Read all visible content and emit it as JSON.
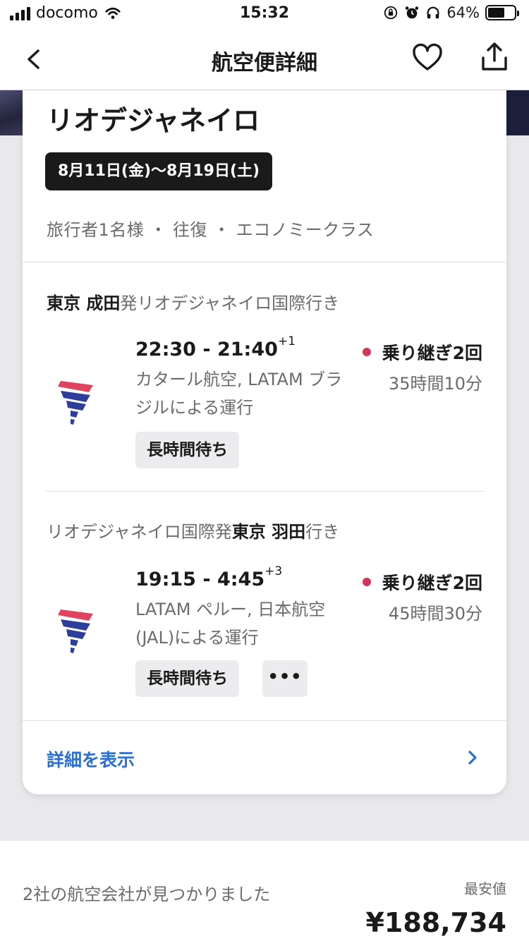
{
  "status_bar": {
    "carrier": "docomo",
    "time": "15:32",
    "battery": "64%",
    "battery_level": 0.64
  },
  "nav": {
    "title": "航空便詳細"
  },
  "trip": {
    "destination": "リオデジャネイロ",
    "dates": "8月11日(金)〜8月19日(土)",
    "travelers": "旅行者1名様 ・ 往復 ・ エコノミークラス"
  },
  "legs": [
    {
      "origin_bold": "東京 成田",
      "route_rest": "発リオデジャネイロ国際行き",
      "times": "22:30 - 21:40",
      "day_offset": "+1",
      "stops": "乗り継ぎ2回",
      "airlines_line1": "カタール航空, LATAM ブラ",
      "airlines_line2": "ジルによる運行",
      "duration": "35時間10分",
      "tags": [
        "長時間待ち"
      ]
    },
    {
      "route_start": "リオデジャネイロ国際発",
      "dest_bold": "東京 羽田",
      "route_end": "行き",
      "times": "19:15 - 4:45",
      "day_offset": "+3",
      "stops": "乗り継ぎ2回",
      "airlines_line1": "LATAM ペルー, 日本航空",
      "airlines_line2": "(JAL)による運行",
      "duration": "45時間30分",
      "tags": [
        "長時間待ち"
      ],
      "more_label": "•••"
    }
  ],
  "details_link": "詳細を表示",
  "summary": {
    "found": "2社の航空会社が見つかりました",
    "lowest_label": "最安値",
    "price": "¥188,734"
  },
  "colors": {
    "accent_link": "#2a6fd6",
    "stop_dot": "#d1365b",
    "logo_red": "#e0435f",
    "logo_blue": "#2d3d9a"
  }
}
